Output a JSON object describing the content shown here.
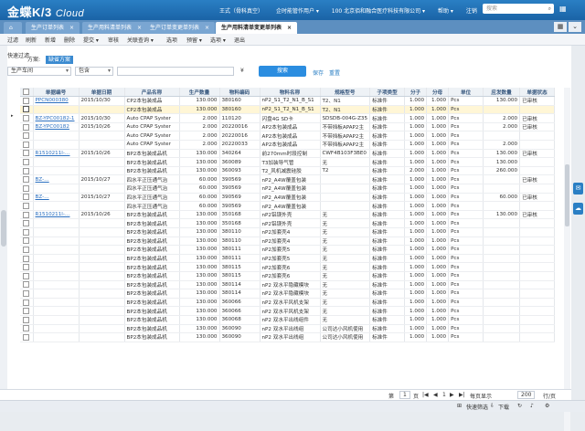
{
  "app": {
    "logo_main": "金蝶K/3",
    "logo_sub": "Cloud",
    "menu": [
      "王式（骨科真空）",
      "企时能管作用户 ▾",
      "100 北京佰和融合医疗科技有限公司 ▾",
      "帮助 ▾",
      "注销"
    ],
    "search_placeholder": "搜索"
  },
  "tabs": [
    {
      "label": "生产订单列表"
    },
    {
      "label": "生产用料清单列表"
    },
    {
      "label": "生产订单变更单列表"
    },
    {
      "label": "生产用料清单变更单列表"
    }
  ],
  "toolbar": [
    "过滤",
    "刷新",
    "新增",
    "删除",
    "提交 ▾",
    "审核",
    "关联查询 ▾",
    "选项",
    "预留 ▾",
    "选项 ▾",
    "退出"
  ],
  "filter": {
    "quick_label": "快速过滤",
    "scheme_label": "方案:",
    "scheme_value": "缺省方案",
    "field_value": "生产车间",
    "op_value": "包含",
    "search_button": "搜索",
    "save_link": "保存",
    "reset_link": "重置"
  },
  "table": {
    "columns": [
      "单据编号",
      "单据日期",
      "产品名称",
      "生产数量",
      "物料编码",
      "物料名称",
      "规格型号",
      "子项类型",
      "分子",
      "分母",
      "单位",
      "应发数量",
      "单据状态"
    ],
    "rows": [
      [
        "PPCN000380",
        "2015/10/30",
        "CP2本包装成品",
        "130.000",
        "380160",
        "nP2_S1_T2_N1_B_S1",
        "T2、N1",
        "标准件",
        "1.000",
        "1.000",
        "Pcs",
        "130.000",
        "已审核"
      ],
      [
        "",
        "",
        "CP2本包装成品",
        "130.000",
        "380160",
        "nP2_S1_T2_N1_B_S1",
        "T2、N1",
        "标准件",
        "1.000",
        "1.000",
        "Pcs",
        "",
        ""
      ],
      [
        "BZ-YPC00182-1",
        "2015/10/30",
        "Auto CPAP Syster",
        "2.000",
        "110120",
        "闪盘4G SD卡",
        "SDSDB-004G-Z35",
        "标准件",
        "1.000",
        "1.000",
        "Pcs",
        "2.000",
        "已审核"
      ],
      [
        "BZ-YPC00182",
        "2015/10/26",
        "Auto CPAP Syster",
        "2.000",
        "20220016",
        "AP2本包装成品",
        "不带挡板APAP2主",
        "标准件",
        "1.000",
        "1.000",
        "Pcs",
        "2.000",
        "已审核"
      ],
      [
        "",
        "",
        "Auto CPAP Syster",
        "2.000",
        "20220016",
        "AP2本包装成品",
        "不带挡板APAP2主",
        "标准件",
        "1.000",
        "1.000",
        "Pcs",
        "",
        ""
      ],
      [
        "",
        "",
        "Auto CPAP Syster",
        "2.000",
        "20220033",
        "AP2本包装成品",
        "不带挡板APAP2主",
        "标准件",
        "1.000",
        "1.000",
        "Pcs",
        "2.000",
        ""
      ],
      [
        "R1510211l-…",
        "2015/10/26",
        "BP2本包装成品机",
        "130.000",
        "340264",
        "前270mm时段控制",
        "CWF4B103F3BE0",
        "标准件",
        "1.000",
        "1.000",
        "Pcs",
        "130.000",
        "已审核"
      ],
      [
        "",
        "",
        "BP2本包装成品机",
        "130.000",
        "360089",
        "T3加装导气管",
        "无",
        "标准件",
        "1.000",
        "1.000",
        "Pcs",
        "130.000",
        ""
      ],
      [
        "",
        "",
        "BP2本包装成品机",
        "130.000",
        "360093",
        "T2_风机减震硅胶",
        "T2",
        "标准件",
        "2.000",
        "1.000",
        "Pcs",
        "260.000",
        ""
      ],
      [
        "BZ-…",
        "2015/10/27",
        "四水平正压通气治",
        "60.000",
        "390569",
        "nP2_A4W覆盖包装",
        "",
        "标准件",
        "1.000",
        "1.000",
        "Pcs",
        "",
        "已审核"
      ],
      [
        "",
        "",
        "四水平正压通气治",
        "60.000",
        "390569",
        "nP2_A4W覆盖包装",
        "",
        "标准件",
        "1.000",
        "1.000",
        "Pcs",
        "",
        ""
      ],
      [
        "BZ-…",
        "2015/10/27",
        "四水平正压通气治",
        "60.000",
        "390569",
        "nP2_A4W覆盖包装",
        "",
        "标准件",
        "1.000",
        "1.000",
        "Pcs",
        "60.000",
        "已审核"
      ],
      [
        "",
        "",
        "四水平正压通气治",
        "60.000",
        "390569",
        "nP2_A4W覆盖包装",
        "",
        "标准件",
        "1.000",
        "1.000",
        "Pcs",
        "",
        ""
      ],
      [
        "R1510211l-…",
        "2015/10/26",
        "BP2本包装成品机",
        "130.000",
        "350168",
        "nP2铝镁外壳",
        "无",
        "标准件",
        "1.000",
        "1.000",
        "Pcs",
        "130.000",
        "已审核"
      ],
      [
        "",
        "",
        "BP2本包装成品机",
        "130.000",
        "350168",
        "nP2铝镁外壳",
        "无",
        "标准件",
        "1.000",
        "1.000",
        "Pcs",
        "",
        ""
      ],
      [
        "",
        "",
        "BP2本包装成品机",
        "130.000",
        "380110",
        "nP2加套壳4",
        "无",
        "标准件",
        "1.000",
        "1.000",
        "Pcs",
        "",
        ""
      ],
      [
        "",
        "",
        "BP2本包装成品机",
        "130.000",
        "380110",
        "nP2加套壳4",
        "无",
        "标准件",
        "1.000",
        "1.000",
        "Pcs",
        "",
        ""
      ],
      [
        "",
        "",
        "BP2本包装成品机",
        "130.000",
        "380111",
        "nP2加套壳5",
        "无",
        "标准件",
        "1.000",
        "1.000",
        "Pcs",
        "",
        ""
      ],
      [
        "",
        "",
        "BP2本包装成品机",
        "130.000",
        "380111",
        "nP2加套壳5",
        "无",
        "标准件",
        "1.000",
        "1.000",
        "Pcs",
        "",
        ""
      ],
      [
        "",
        "",
        "BP2本包装成品机",
        "130.000",
        "380115",
        "nP2加套壳6",
        "无",
        "标准件",
        "1.000",
        "1.000",
        "Pcs",
        "",
        ""
      ],
      [
        "",
        "",
        "BP2本包装成品机",
        "130.000",
        "380115",
        "nP2加套壳6",
        "无",
        "标准件",
        "1.000",
        "1.000",
        "Pcs",
        "",
        ""
      ],
      [
        "",
        "",
        "BP2本包装成品机",
        "130.000",
        "380114",
        "nP2 双水平隐藏模块",
        "无",
        "标准件",
        "1.000",
        "1.000",
        "Pcs",
        "",
        ""
      ],
      [
        "",
        "",
        "BP2本包装成品机",
        "130.000",
        "380114",
        "nP2 双水平隐藏模块",
        "无",
        "标准件",
        "1.000",
        "1.000",
        "Pcs",
        "",
        ""
      ],
      [
        "",
        "",
        "BP2本包装成品机",
        "130.000",
        "360066",
        "nP2 双水平风机支架",
        "无",
        "标准件",
        "1.000",
        "1.000",
        "Pcs",
        "",
        ""
      ],
      [
        "",
        "",
        "BP2本包装成品机",
        "130.000",
        "360066",
        "nP2 双水平风机支架",
        "无",
        "标准件",
        "1.000",
        "1.000",
        "Pcs",
        "",
        ""
      ],
      [
        "",
        "",
        "BP2本包装成品机",
        "130.000",
        "360068",
        "nP2 双水平出线组件",
        "无",
        "标准件",
        "1.000",
        "1.000",
        "Pcs",
        "",
        ""
      ],
      [
        "",
        "",
        "BP2本包装成品机",
        "130.000",
        "360090",
        "nP2 双水平出线组",
        "公司达小风机使用",
        "标准件",
        "1.000",
        "1.000",
        "Pcs",
        "",
        ""
      ],
      [
        "",
        "",
        "BP2本包装成品机",
        "130.000",
        "360090",
        "nP2 双水平出线组",
        "公司达小风机使用",
        "标准件",
        "1.000",
        "1.000",
        "Pcs",
        "",
        ""
      ]
    ]
  },
  "pager": {
    "page_label": "第",
    "page_value": "1",
    "page_suffix": "页",
    "total": "1",
    "per_page_label": "每页显示",
    "per_page_value": "200",
    "per_page_suffix": "行/页"
  },
  "status": {
    "left": "",
    "filter_label": "快速筛选",
    "dl_label": "下载"
  }
}
